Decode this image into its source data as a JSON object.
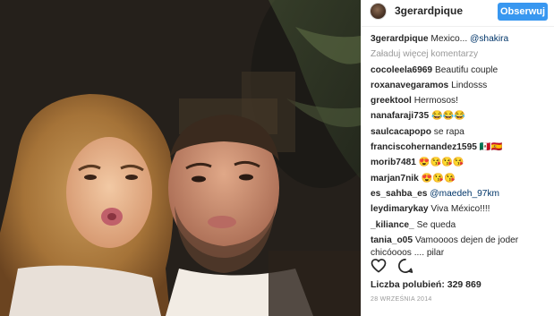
{
  "post": {
    "photo_alt": "selfie photo",
    "header": {
      "username": "3gerardpique",
      "follow_label": "Obserwuj"
    },
    "caption": {
      "username": "3gerardpique",
      "text": "Mexico... ",
      "mention": "@shakira"
    },
    "load_more_label": "Załaduj więcej komentarzy",
    "comments": [
      {
        "username": "cocoleela6969",
        "text": "Beautifu couple"
      },
      {
        "username": "roxanavegaramos",
        "text": "Lindosss"
      },
      {
        "username": "greektool",
        "text": "Hermosos!"
      },
      {
        "username": "nanafaraji735",
        "text": "😂😂😂"
      },
      {
        "username": "saulcacapopo",
        "text": "se rapa"
      },
      {
        "username": "franciscohernandez1595",
        "text": "🇲🇽🇪🇸"
      },
      {
        "username": "morib7481",
        "text": "😍😘😘😘"
      },
      {
        "username": "marjan7nik",
        "text": "😍😘😘"
      },
      {
        "username": "es_sahba_es",
        "mention": "@maedeh_97km"
      },
      {
        "username": "leydimarykay",
        "text": "Viva México!!!!"
      },
      {
        "username": "_kiliance_",
        "text": "Se queda"
      },
      {
        "username": "tania_o05",
        "text": "Vamoooos dejen de joder chicóooos .... pilar"
      }
    ],
    "likes_label": "Liczba polubień: 329 869",
    "date": "28 WRZEŚNIA 2014",
    "icons": {
      "like": "heart-icon",
      "comment": "comment-icon"
    },
    "colors": {
      "accent": "#3897f0",
      "muted": "#999999",
      "mention": "#003569",
      "text": "#262626"
    }
  }
}
